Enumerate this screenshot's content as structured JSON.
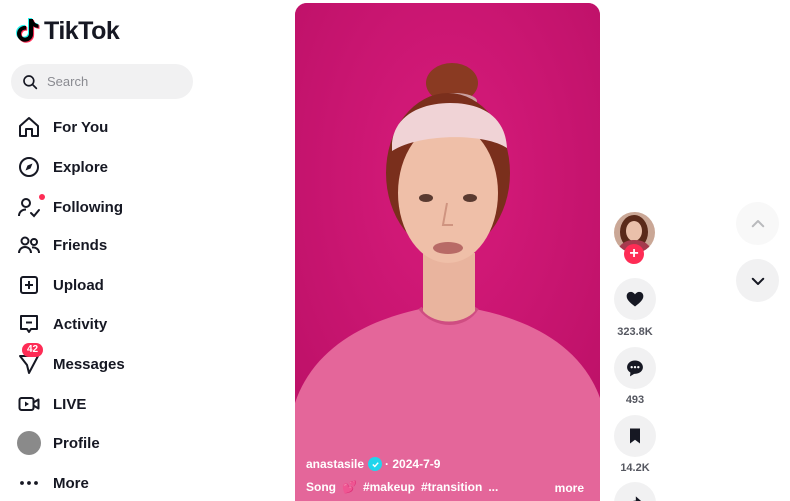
{
  "app": {
    "logo_text": "TikTok"
  },
  "search": {
    "placeholder": "Search"
  },
  "nav": {
    "items": [
      {
        "label": "For You",
        "icon": "home-icon"
      },
      {
        "label": "Explore",
        "icon": "compass-icon"
      },
      {
        "label": "Following",
        "icon": "following-icon"
      },
      {
        "label": "Friends",
        "icon": "friends-icon"
      },
      {
        "label": "Upload",
        "icon": "plus-square-icon"
      },
      {
        "label": "Activity",
        "icon": "activity-icon"
      },
      {
        "label": "Messages",
        "icon": "send-icon",
        "badge": "42"
      },
      {
        "label": "LIVE",
        "icon": "live-icon"
      },
      {
        "label": "Profile",
        "icon": "avatar"
      },
      {
        "label": "More",
        "icon": "ellipsis-icon"
      }
    ]
  },
  "video": {
    "username": "anastasile",
    "date": "· 2024-7-9",
    "caption_song": "Song",
    "caption_emoji": "💕",
    "hashtags": [
      "#makeup",
      "#transition",
      "..."
    ],
    "more_label": "more"
  },
  "actions": {
    "likes": "323.8K",
    "comments": "493",
    "saves": "14.2K"
  },
  "colors": {
    "brand_red": "#fe2c55",
    "video_bg": "#c7136e",
    "verified": "#20d5ec",
    "text": "#161823"
  }
}
